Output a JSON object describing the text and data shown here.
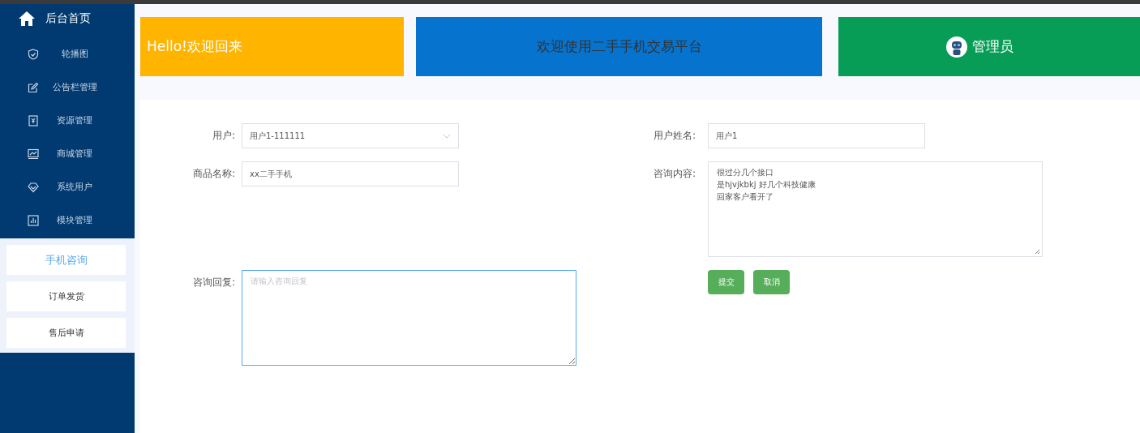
{
  "sidebar": {
    "home": {
      "label": "后台首页"
    },
    "items": [
      {
        "label": "轮播图"
      },
      {
        "label": "公告栏管理"
      },
      {
        "label": "资源管理"
      },
      {
        "label": "商城管理"
      },
      {
        "label": "系统用户"
      },
      {
        "label": "模块管理"
      }
    ],
    "subitems": [
      {
        "label": "手机咨询",
        "selected": true
      },
      {
        "label": "订单发货",
        "selected": false
      },
      {
        "label": "售后申请",
        "selected": false
      }
    ]
  },
  "header": {
    "greeting": "Hello!欢迎回来",
    "title": "欢迎使用二手手机交易平台",
    "role": "管理员"
  },
  "form": {
    "user": {
      "label": "用户:",
      "value": "用户1-111111"
    },
    "user_name": {
      "label": "用户姓名:",
      "value": "用户1"
    },
    "product_name": {
      "label": "商品名称:",
      "value": "xx二手手机"
    },
    "content": {
      "label": "咨询内容:",
      "lines": [
        "很过分几个接口",
        "是hjvjkbkj 好几个科技健康",
        "回家客户看开了"
      ]
    },
    "reply": {
      "label": "咨询回复:",
      "placeholder": "请输入咨询回复",
      "focused": true
    },
    "buttons": [
      "提交",
      "取消"
    ]
  }
}
